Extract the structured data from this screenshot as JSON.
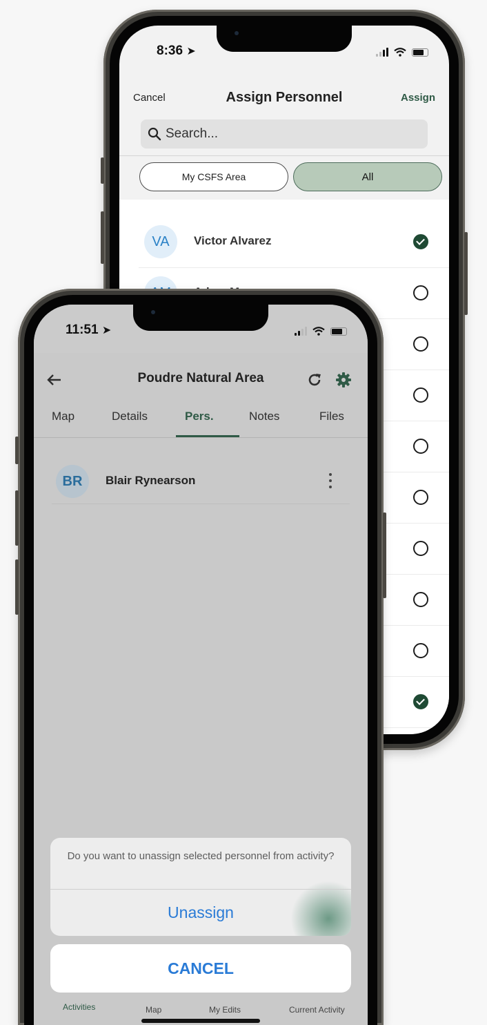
{
  "colors": {
    "accent": "#2f5a46",
    "link_blue": "#2a7bd6",
    "avatar_text": "#2a81c6"
  },
  "back_screen": {
    "status": {
      "time": "8:36"
    },
    "header": {
      "cancel_label": "Cancel",
      "title": "Assign Personnel",
      "assign_label": "Assign"
    },
    "search": {
      "placeholder": "Search..."
    },
    "filters": {
      "left": "My CSFS Area",
      "right": "All",
      "selected": "All"
    },
    "personnel": [
      {
        "initials": "VA",
        "name": "Victor Alvarez",
        "checked": true
      },
      {
        "initials": "AM",
        "name": "Adam Moore",
        "checked": false
      },
      {
        "checked": false
      },
      {
        "checked": false
      },
      {
        "checked": false
      },
      {
        "checked": false
      },
      {
        "checked": false
      },
      {
        "checked": false
      },
      {
        "checked": false
      },
      {
        "checked": true
      }
    ]
  },
  "front_screen": {
    "status": {
      "time": "11:51"
    },
    "toolbar": {
      "title": "Poudre Natural Area",
      "back_icon": "arrow-left-icon",
      "refresh_icon": "refresh-icon",
      "settings_icon": "gear-icon"
    },
    "tabs": [
      {
        "label": "Map"
      },
      {
        "label": "Details"
      },
      {
        "label": "Pers.",
        "active": true
      },
      {
        "label": "Notes"
      },
      {
        "label": "Files"
      }
    ],
    "assigned": {
      "initials": "BR",
      "name": "Blair Rynearson"
    },
    "action_sheet": {
      "message": "Do you want to unassign selected personnel from activity?",
      "action_label": "Unassign",
      "cancel_label": "CANCEL"
    },
    "bottom_nav": [
      {
        "label": "Activities",
        "active": true
      },
      {
        "label": "Map"
      },
      {
        "label": "My Edits"
      },
      {
        "label": "Current Activity"
      }
    ]
  }
}
